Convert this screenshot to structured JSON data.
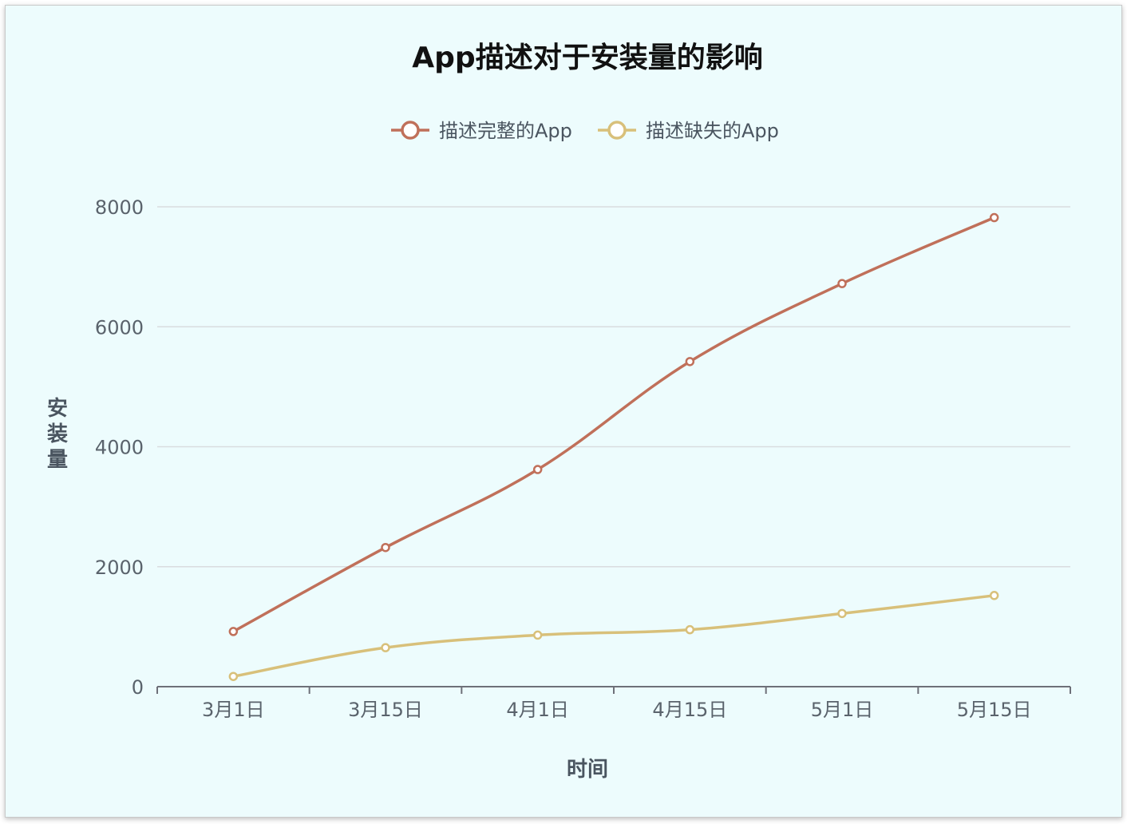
{
  "chart_data": {
    "type": "line",
    "title": "App描述对于安装量的影响",
    "xlabel": "时间",
    "ylabel": "安装量",
    "categories": [
      "3月1日",
      "3月15日",
      "4月1日",
      "4月15日",
      "5月1日",
      "5月15日"
    ],
    "ylim": [
      0,
      8000
    ],
    "yticks": [
      0,
      2000,
      4000,
      6000,
      8000
    ],
    "grid": true,
    "legend_position": "top-center",
    "smooth": true,
    "series": [
      {
        "name": "描述完整的App",
        "color": "#c0705a",
        "values": [
          920,
          2320,
          3620,
          5420,
          6720,
          7820
        ]
      },
      {
        "name": "描述缺失的App",
        "color": "#d8c07a",
        "values": [
          170,
          650,
          860,
          950,
          1220,
          1520
        ]
      }
    ]
  }
}
